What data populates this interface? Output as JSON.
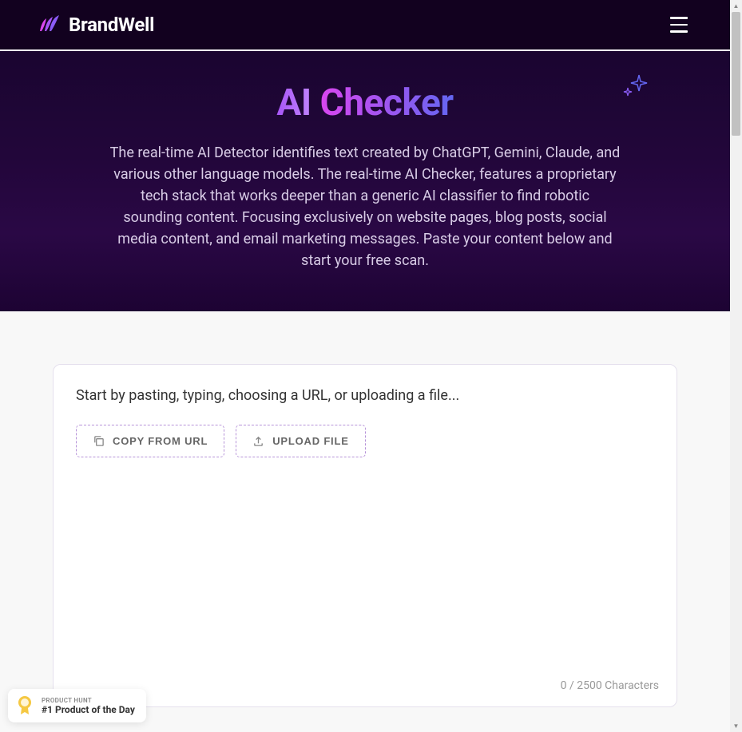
{
  "header": {
    "brand_name": "BrandWell"
  },
  "hero": {
    "title_part1": "AI",
    "title_part2": "Checker",
    "description": "The real-time AI Detector identifies text created by ChatGPT, Gemini, Claude, and various other language models. The real-time AI Checker, features a proprietary tech stack that works deeper than a generic AI classifier to find robotic sounding content. Focusing exclusively on website pages, blog posts, social media content, and email marketing messages. Paste your content below and start your free scan."
  },
  "card": {
    "placeholder": "Start by pasting, typing, choosing a URL, or uploading a file...",
    "copy_url_label": "COPY FROM URL",
    "upload_label": "UPLOAD FILE",
    "char_count": "0 / 2500 Characters"
  },
  "badge": {
    "label": "PRODUCT HUNT",
    "title": "#1 Product of the Day"
  }
}
